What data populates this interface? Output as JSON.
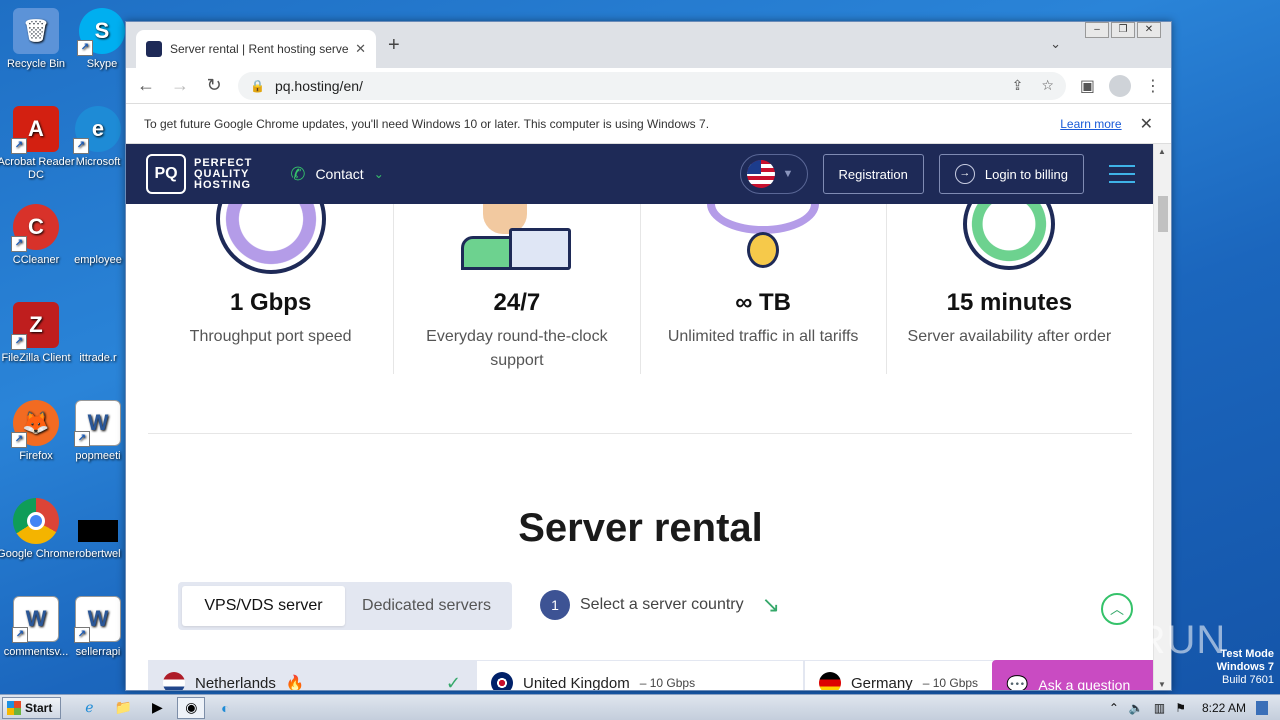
{
  "desktop": {
    "icons": [
      {
        "label": "Recycle Bin",
        "icon": "recycle-bin-icon",
        "color": "#3a7bd5"
      },
      {
        "label": "Skype",
        "icon": "skype-icon",
        "color": "#00aff0"
      },
      {
        "label": "Acrobat Reader DC",
        "icon": "acrobat-icon",
        "color": "#d32011"
      },
      {
        "label": "Microsoft",
        "icon": "edge-icon",
        "color": "#1e8bd6"
      },
      {
        "label": "CCleaner",
        "icon": "ccleaner-icon",
        "color": "#d8322a"
      },
      {
        "label": "employee",
        "icon": "blank-doc-icon",
        "color": "#1f6fc4"
      },
      {
        "label": "FileZilla Client",
        "icon": "filezilla-icon",
        "color": "#bf1e1e"
      },
      {
        "label": "ittrade.r",
        "icon": "blank-doc-icon",
        "color": "#1f6fc4"
      },
      {
        "label": "Firefox",
        "icon": "firefox-icon",
        "color": "#f26b22"
      },
      {
        "label": "popmeeti",
        "icon": "word-doc-icon",
        "color": "#2b5797"
      },
      {
        "label": "Google Chrome",
        "icon": "chrome-icon",
        "color": "#dd4b39"
      },
      {
        "label": "robertwel",
        "icon": "black-file-icon",
        "color": "#000000"
      },
      {
        "label": "commentsv...",
        "icon": "word-doc-icon",
        "color": "#2b5797"
      },
      {
        "label": "sellerrapi",
        "icon": "word-doc-icon",
        "color": "#2b5797"
      }
    ]
  },
  "browser": {
    "tab_title": "Server rental | Rent hosting servers",
    "tab_close": "✕",
    "new_tab": "+",
    "url": "pq.hosting/en/",
    "infobar_text": "To get future Google Chrome updates, you'll need Windows 10 or later. This computer is using Windows 7.",
    "learn_more": "Learn more"
  },
  "site": {
    "logo_mark": "PQ",
    "logo_lines": [
      "PERFECT",
      "QUALITY",
      "HOSTING"
    ],
    "contact": "Contact",
    "registration": "Registration",
    "login": "Login to billing",
    "features": [
      {
        "value": "1 Gbps",
        "desc": "Throughput port speed"
      },
      {
        "value": "24/7",
        "desc": "Everyday round-the-clock support"
      },
      {
        "value": "∞ TB",
        "desc": "Unlimited traffic in all tariffs"
      },
      {
        "value": "15 minutes",
        "desc": "Server availability after order"
      }
    ],
    "section_title": "Server rental",
    "tabs": [
      "VPS/VDS server",
      "Dedicated servers"
    ],
    "step_number": "1",
    "step_text": "Select a server country",
    "countries": [
      {
        "name": "Netherlands",
        "speed": "",
        "selected": true
      },
      {
        "name": "United Kingdom",
        "speed": "– 10 Gbps",
        "selected": false
      },
      {
        "name": "Germany",
        "speed": "– 10 Gbps",
        "selected": false
      }
    ],
    "ask_question": "Ask a question"
  },
  "taskbar": {
    "start": "Start",
    "time": "8:22 AM"
  },
  "watermark": {
    "line1": "Test Mode",
    "line2": "Windows 7",
    "line3": "Build 7601",
    "brand": "ANY RUN"
  }
}
